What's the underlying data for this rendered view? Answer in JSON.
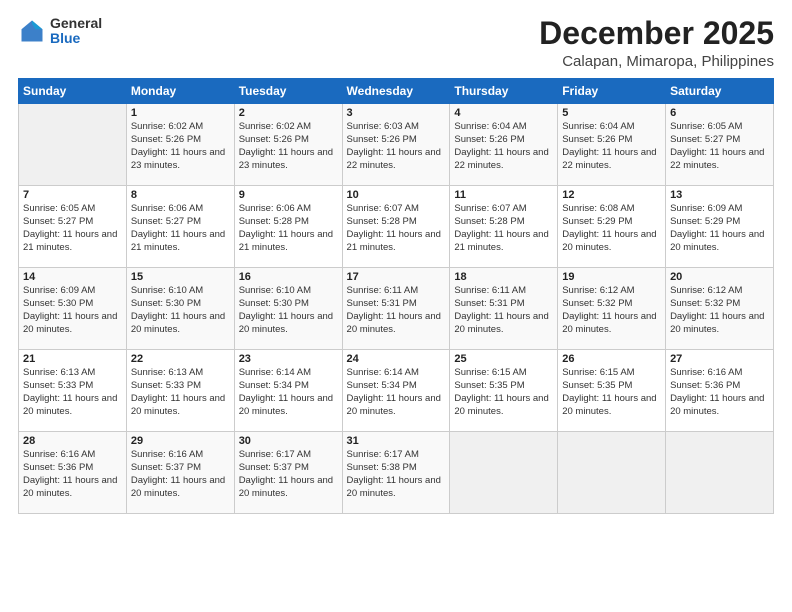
{
  "logo": {
    "general": "General",
    "blue": "Blue"
  },
  "title": "December 2025",
  "subtitle": "Calapan, Mimaropa, Philippines",
  "days_of_week": [
    "Sunday",
    "Monday",
    "Tuesday",
    "Wednesday",
    "Thursday",
    "Friday",
    "Saturday"
  ],
  "weeks": [
    [
      {
        "day": "",
        "sunrise": "",
        "sunset": "",
        "daylight": ""
      },
      {
        "day": "1",
        "sunrise": "Sunrise: 6:02 AM",
        "sunset": "Sunset: 5:26 PM",
        "daylight": "Daylight: 11 hours and 23 minutes."
      },
      {
        "day": "2",
        "sunrise": "Sunrise: 6:02 AM",
        "sunset": "Sunset: 5:26 PM",
        "daylight": "Daylight: 11 hours and 23 minutes."
      },
      {
        "day": "3",
        "sunrise": "Sunrise: 6:03 AM",
        "sunset": "Sunset: 5:26 PM",
        "daylight": "Daylight: 11 hours and 22 minutes."
      },
      {
        "day": "4",
        "sunrise": "Sunrise: 6:04 AM",
        "sunset": "Sunset: 5:26 PM",
        "daylight": "Daylight: 11 hours and 22 minutes."
      },
      {
        "day": "5",
        "sunrise": "Sunrise: 6:04 AM",
        "sunset": "Sunset: 5:26 PM",
        "daylight": "Daylight: 11 hours and 22 minutes."
      },
      {
        "day": "6",
        "sunrise": "Sunrise: 6:05 AM",
        "sunset": "Sunset: 5:27 PM",
        "daylight": "Daylight: 11 hours and 22 minutes."
      }
    ],
    [
      {
        "day": "7",
        "sunrise": "Sunrise: 6:05 AM",
        "sunset": "Sunset: 5:27 PM",
        "daylight": "Daylight: 11 hours and 21 minutes."
      },
      {
        "day": "8",
        "sunrise": "Sunrise: 6:06 AM",
        "sunset": "Sunset: 5:27 PM",
        "daylight": "Daylight: 11 hours and 21 minutes."
      },
      {
        "day": "9",
        "sunrise": "Sunrise: 6:06 AM",
        "sunset": "Sunset: 5:28 PM",
        "daylight": "Daylight: 11 hours and 21 minutes."
      },
      {
        "day": "10",
        "sunrise": "Sunrise: 6:07 AM",
        "sunset": "Sunset: 5:28 PM",
        "daylight": "Daylight: 11 hours and 21 minutes."
      },
      {
        "day": "11",
        "sunrise": "Sunrise: 6:07 AM",
        "sunset": "Sunset: 5:28 PM",
        "daylight": "Daylight: 11 hours and 21 minutes."
      },
      {
        "day": "12",
        "sunrise": "Sunrise: 6:08 AM",
        "sunset": "Sunset: 5:29 PM",
        "daylight": "Daylight: 11 hours and 20 minutes."
      },
      {
        "day": "13",
        "sunrise": "Sunrise: 6:09 AM",
        "sunset": "Sunset: 5:29 PM",
        "daylight": "Daylight: 11 hours and 20 minutes."
      }
    ],
    [
      {
        "day": "14",
        "sunrise": "Sunrise: 6:09 AM",
        "sunset": "Sunset: 5:30 PM",
        "daylight": "Daylight: 11 hours and 20 minutes."
      },
      {
        "day": "15",
        "sunrise": "Sunrise: 6:10 AM",
        "sunset": "Sunset: 5:30 PM",
        "daylight": "Daylight: 11 hours and 20 minutes."
      },
      {
        "day": "16",
        "sunrise": "Sunrise: 6:10 AM",
        "sunset": "Sunset: 5:30 PM",
        "daylight": "Daylight: 11 hours and 20 minutes."
      },
      {
        "day": "17",
        "sunrise": "Sunrise: 6:11 AM",
        "sunset": "Sunset: 5:31 PM",
        "daylight": "Daylight: 11 hours and 20 minutes."
      },
      {
        "day": "18",
        "sunrise": "Sunrise: 6:11 AM",
        "sunset": "Sunset: 5:31 PM",
        "daylight": "Daylight: 11 hours and 20 minutes."
      },
      {
        "day": "19",
        "sunrise": "Sunrise: 6:12 AM",
        "sunset": "Sunset: 5:32 PM",
        "daylight": "Daylight: 11 hours and 20 minutes."
      },
      {
        "day": "20",
        "sunrise": "Sunrise: 6:12 AM",
        "sunset": "Sunset: 5:32 PM",
        "daylight": "Daylight: 11 hours and 20 minutes."
      }
    ],
    [
      {
        "day": "21",
        "sunrise": "Sunrise: 6:13 AM",
        "sunset": "Sunset: 5:33 PM",
        "daylight": "Daylight: 11 hours and 20 minutes."
      },
      {
        "day": "22",
        "sunrise": "Sunrise: 6:13 AM",
        "sunset": "Sunset: 5:33 PM",
        "daylight": "Daylight: 11 hours and 20 minutes."
      },
      {
        "day": "23",
        "sunrise": "Sunrise: 6:14 AM",
        "sunset": "Sunset: 5:34 PM",
        "daylight": "Daylight: 11 hours and 20 minutes."
      },
      {
        "day": "24",
        "sunrise": "Sunrise: 6:14 AM",
        "sunset": "Sunset: 5:34 PM",
        "daylight": "Daylight: 11 hours and 20 minutes."
      },
      {
        "day": "25",
        "sunrise": "Sunrise: 6:15 AM",
        "sunset": "Sunset: 5:35 PM",
        "daylight": "Daylight: 11 hours and 20 minutes."
      },
      {
        "day": "26",
        "sunrise": "Sunrise: 6:15 AM",
        "sunset": "Sunset: 5:35 PM",
        "daylight": "Daylight: 11 hours and 20 minutes."
      },
      {
        "day": "27",
        "sunrise": "Sunrise: 6:16 AM",
        "sunset": "Sunset: 5:36 PM",
        "daylight": "Daylight: 11 hours and 20 minutes."
      }
    ],
    [
      {
        "day": "28",
        "sunrise": "Sunrise: 6:16 AM",
        "sunset": "Sunset: 5:36 PM",
        "daylight": "Daylight: 11 hours and 20 minutes."
      },
      {
        "day": "29",
        "sunrise": "Sunrise: 6:16 AM",
        "sunset": "Sunset: 5:37 PM",
        "daylight": "Daylight: 11 hours and 20 minutes."
      },
      {
        "day": "30",
        "sunrise": "Sunrise: 6:17 AM",
        "sunset": "Sunset: 5:37 PM",
        "daylight": "Daylight: 11 hours and 20 minutes."
      },
      {
        "day": "31",
        "sunrise": "Sunrise: 6:17 AM",
        "sunset": "Sunset: 5:38 PM",
        "daylight": "Daylight: 11 hours and 20 minutes."
      },
      {
        "day": "",
        "sunrise": "",
        "sunset": "",
        "daylight": ""
      },
      {
        "day": "",
        "sunrise": "",
        "sunset": "",
        "daylight": ""
      },
      {
        "day": "",
        "sunrise": "",
        "sunset": "",
        "daylight": ""
      }
    ]
  ]
}
